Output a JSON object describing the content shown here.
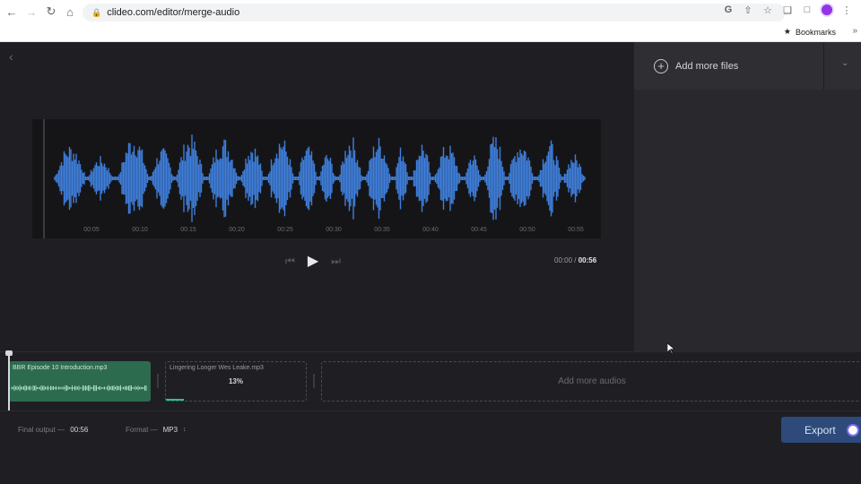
{
  "browser": {
    "url": "clideo.com/editor/merge-audio",
    "bookmarks_label": "Bookmarks"
  },
  "player": {
    "time_labels": [
      "00:05",
      "00:10",
      "00:15",
      "00:20",
      "00:25",
      "00:30",
      "00:35",
      "00:40",
      "00:45",
      "00:50",
      "00:55"
    ],
    "current_time": "00:00",
    "time_separator": "/",
    "total_time": "00:56"
  },
  "side_panel": {
    "add_files_label": "Add more files"
  },
  "timeline": {
    "track1_name": "BBR Episode 10 Introduction.mp3",
    "track2_name": "Lingering Longer Wes Leake.mp3",
    "track2_progress_label": "13%",
    "track2_progress": 0.13,
    "add_audio_label": "Add more audios"
  },
  "footer": {
    "final_output_label": "Final output —",
    "final_output_value": "00:56",
    "format_label": "Format —",
    "format_value": "MP3",
    "export_label": "Export"
  },
  "colors": {
    "waveform": "#3f7fdc",
    "track1": "#2d6b4e",
    "progress": "#2ec38a",
    "export": "#2d4a7a"
  }
}
